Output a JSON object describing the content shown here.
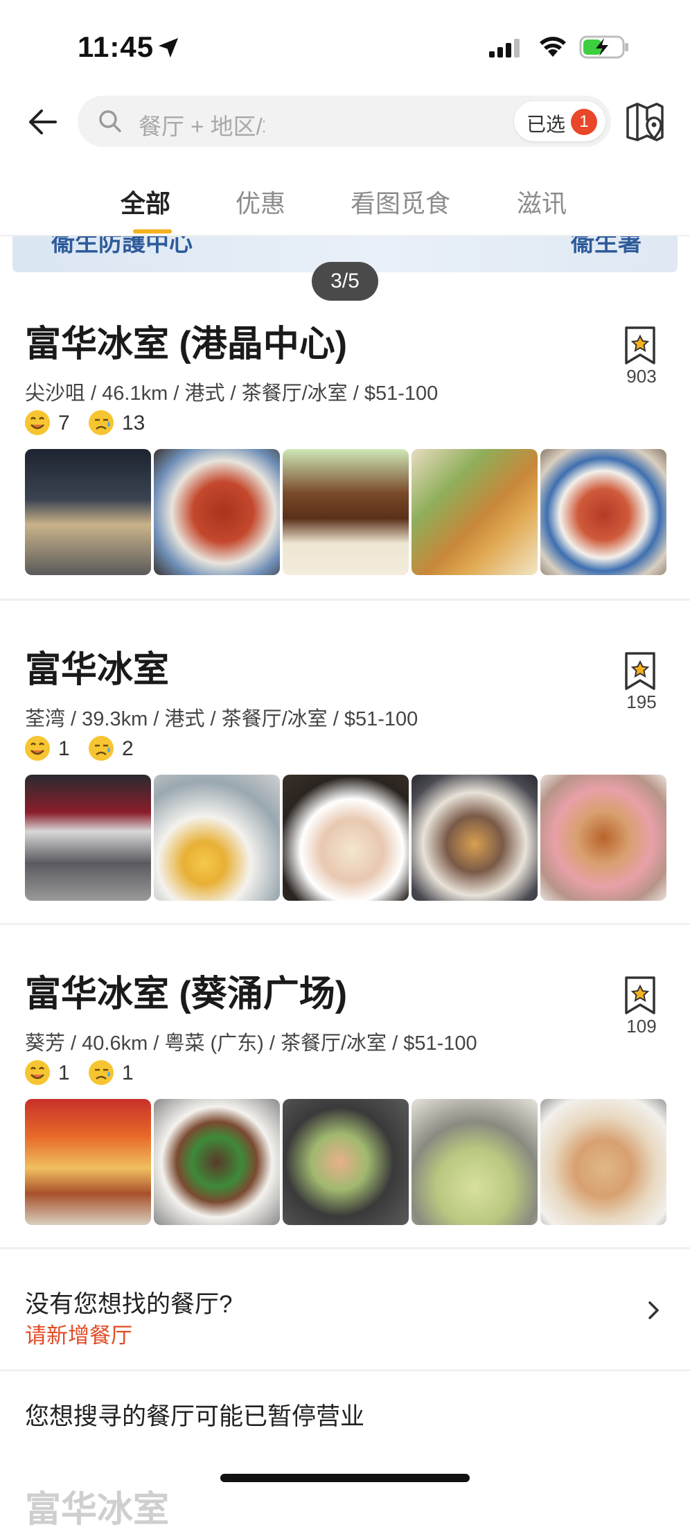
{
  "status_bar": {
    "time": "11:45"
  },
  "header": {
    "search_placeholder": "餐厅 + 地区/地址, 菜式/食品...",
    "selected_label": "已选",
    "selected_count": "1"
  },
  "tabs": [
    {
      "label": "全部",
      "active": true
    },
    {
      "label": "优惠",
      "active": false
    },
    {
      "label": "看图觅食",
      "active": false
    },
    {
      "label": "滋讯",
      "active": false
    }
  ],
  "banner": {
    "left_text": "衞生防護中心",
    "right_text": "衞生署",
    "pager": "3/5"
  },
  "restaurants": [
    {
      "name": "富华冰室 (港晶中心)",
      "meta": "尖沙咀 / 46.1km / 港式 / 茶餐厅/冰室 / $51-100",
      "smile": "7",
      "sad": "13",
      "bookmarks": "903"
    },
    {
      "name": "富华冰室",
      "meta": "荃湾 / 39.3km / 港式 / 茶餐厅/冰室 / $51-100",
      "smile": "1",
      "sad": "2",
      "bookmarks": "195"
    },
    {
      "name": "富华冰室 (葵涌广场)",
      "meta": "葵芳 / 40.6km / 粤菜 (广东) / 茶餐厅/冰室 / $51-100",
      "smile": "1",
      "sad": "1",
      "bookmarks": "109"
    }
  ],
  "not_found": {
    "question": "没有您想找的餐厅?",
    "action": "请新增餐厅"
  },
  "closed_note": "您想搜寻的餐厅可能已暂停营业",
  "peek_title": "富华冰室",
  "colors": {
    "accent": "#e14b26",
    "tab_indicator": "#f5b11e",
    "badge": "#e8472a"
  }
}
